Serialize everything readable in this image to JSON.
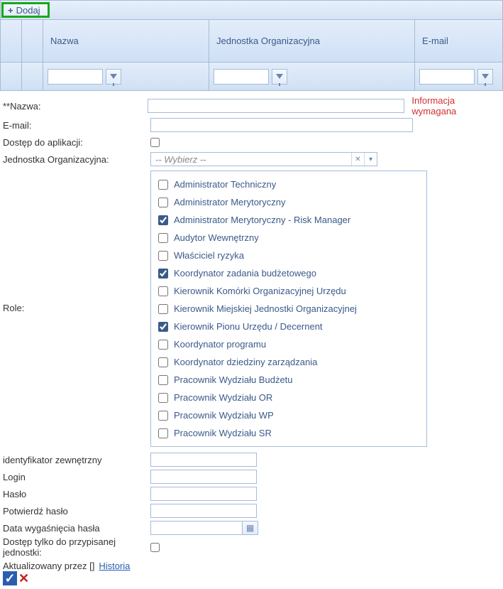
{
  "toolbar": {
    "add_label": "Dodaj"
  },
  "grid": {
    "columns": {
      "name": "Nazwa",
      "unit": "Jednostka Organizacyjna",
      "email": "E-mail"
    }
  },
  "form": {
    "name_label": "**Nazwa:",
    "email_label": "E-mail:",
    "access_label": "Dostęp do aplikacji:",
    "unit_label": "Jednostka Organizacyjna:",
    "unit_placeholder": "-- Wybierz --",
    "role_label": "Role:",
    "ext_id_label": "identyfikator zewnętrzny",
    "login_label": "Login",
    "password_label": "Hasło",
    "confirm_label": "Potwierdź hasło",
    "expiry_label": "Data wygaśnięcia hasła",
    "restrict_label": "Dostęp tylko do przypisanej jednostki:",
    "updated_label": "Aktualizowany przez []",
    "history_link": "Historia",
    "required_msg": "Informacja wymagana"
  },
  "roles": [
    {
      "label": "Administrator Techniczny",
      "checked": false
    },
    {
      "label": "Administrator Merytoryczny",
      "checked": false
    },
    {
      "label": "Administrator Merytoryczny - Risk Manager",
      "checked": true
    },
    {
      "label": "Audytor Wewnętrzny",
      "checked": false
    },
    {
      "label": "Właściciel ryzyka",
      "checked": false
    },
    {
      "label": "Koordynator zadania budżetowego",
      "checked": true
    },
    {
      "label": "Kierownik Komórki Organizacyjnej Urzędu",
      "checked": false
    },
    {
      "label": "Kierownik Miejskiej Jednostki Organizacyjnej",
      "checked": false
    },
    {
      "label": "Kierownik Pionu Urzędu / Decernent",
      "checked": true
    },
    {
      "label": "Koordynator programu",
      "checked": false
    },
    {
      "label": "Koordynator dziedziny zarządzania",
      "checked": false
    },
    {
      "label": "Pracownik Wydziału Budżetu",
      "checked": false
    },
    {
      "label": "Pracownik Wydziału OR",
      "checked": false
    },
    {
      "label": "Pracownik Wydziału WP",
      "checked": false
    },
    {
      "label": "Pracownik Wydziału SR",
      "checked": false
    }
  ]
}
